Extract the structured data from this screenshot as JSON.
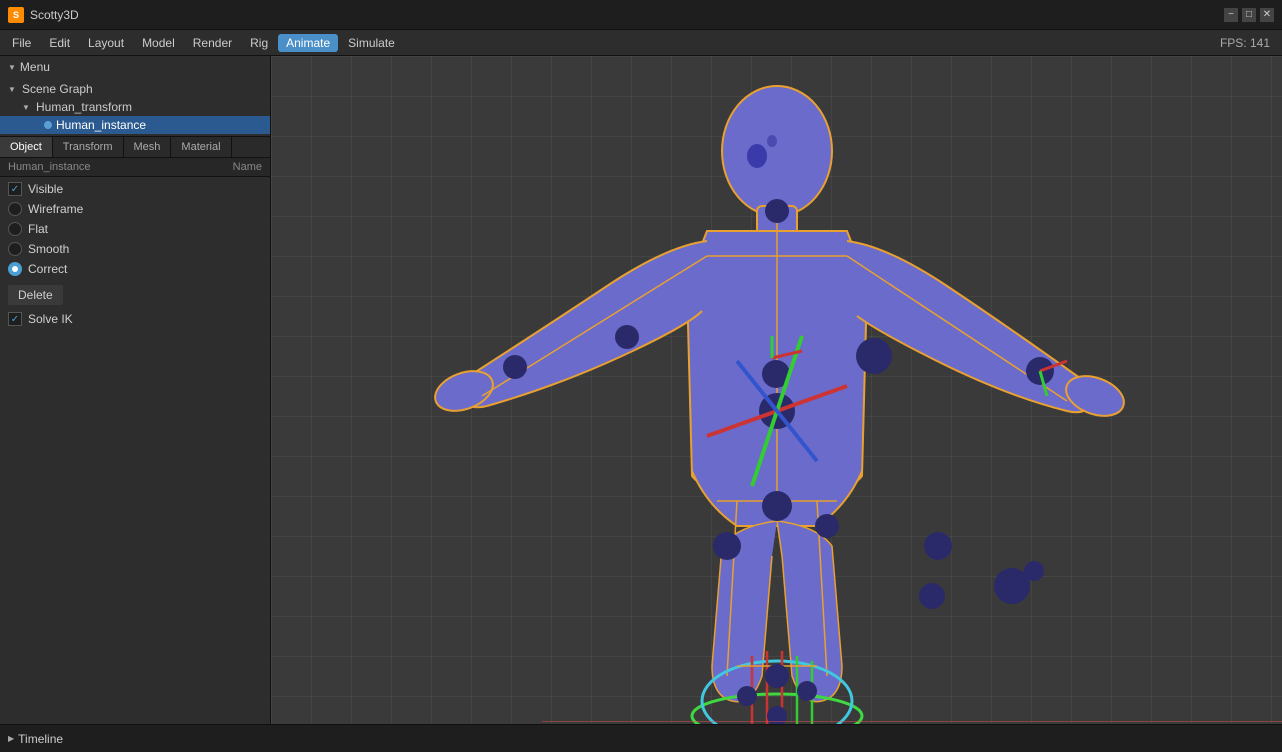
{
  "titlebar": {
    "icon_label": "S",
    "title": "Scotty3D",
    "minimize": "−",
    "maximize": "□",
    "close": "✕"
  },
  "menubar": {
    "items": [
      "File",
      "Edit",
      "Layout",
      "Model",
      "Render",
      "Rig",
      "Animate",
      "Simulate"
    ],
    "active_item": "Animate",
    "fps_label": "FPS: 141"
  },
  "sidebar": {
    "menu_label": "Menu",
    "scene_graph_label": "Scene Graph",
    "human_transform_label": "Human_transform",
    "human_instance_label": "Human_instance",
    "tabs": [
      "Object",
      "Transform",
      "Mesh",
      "Material"
    ],
    "active_tab": "Object",
    "props_col1": "Human_instance",
    "props_col2": "Name",
    "properties": [
      {
        "type": "checkbox",
        "checked": true,
        "label": "Visible"
      },
      {
        "type": "radio",
        "checked": false,
        "label": "Wireframe"
      },
      {
        "type": "radio",
        "checked": false,
        "label": "Flat"
      },
      {
        "type": "radio",
        "checked": false,
        "label": "Smooth"
      },
      {
        "type": "radio",
        "checked": true,
        "label": "Correct"
      }
    ],
    "delete_label": "Delete",
    "solve_ik_label": "Solve IK",
    "solve_ik_checked": true
  },
  "timeline": {
    "arrow": "▶",
    "label": "Timeline"
  },
  "colors": {
    "accent_blue": "#4a8fc7",
    "human_fill": "#6b6bcc",
    "human_outline": "#e8a030",
    "joint_color": "#2a2a6a",
    "axis_x": "#cc3333",
    "axis_y": "#33cc33",
    "axis_z": "#3333cc",
    "ik_cyan": "#40c8e0",
    "ik_green": "#40d840"
  }
}
